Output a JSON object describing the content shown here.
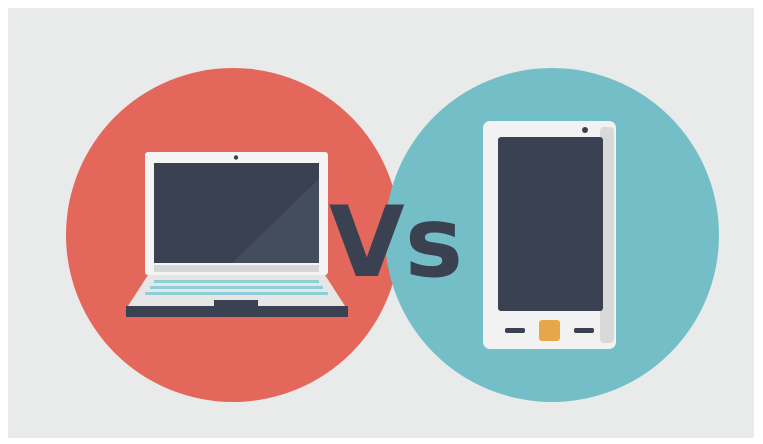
{
  "illustration": {
    "vs_text": "Vs",
    "colors": {
      "background": "#e9eaea",
      "left_circle": "#e3675a",
      "right_circle": "#74bfc7",
      "dark": "#3a4251",
      "device_body": "#e1e1e1",
      "device_bezel": "#f2f2f2",
      "screen_highlight": "#444d5c",
      "home_button": "#e8a64a",
      "keyboard_lines": "#8fd0d8"
    },
    "icons": {
      "laptop": "laptop-icon",
      "smartphone": "smartphone-icon"
    }
  }
}
